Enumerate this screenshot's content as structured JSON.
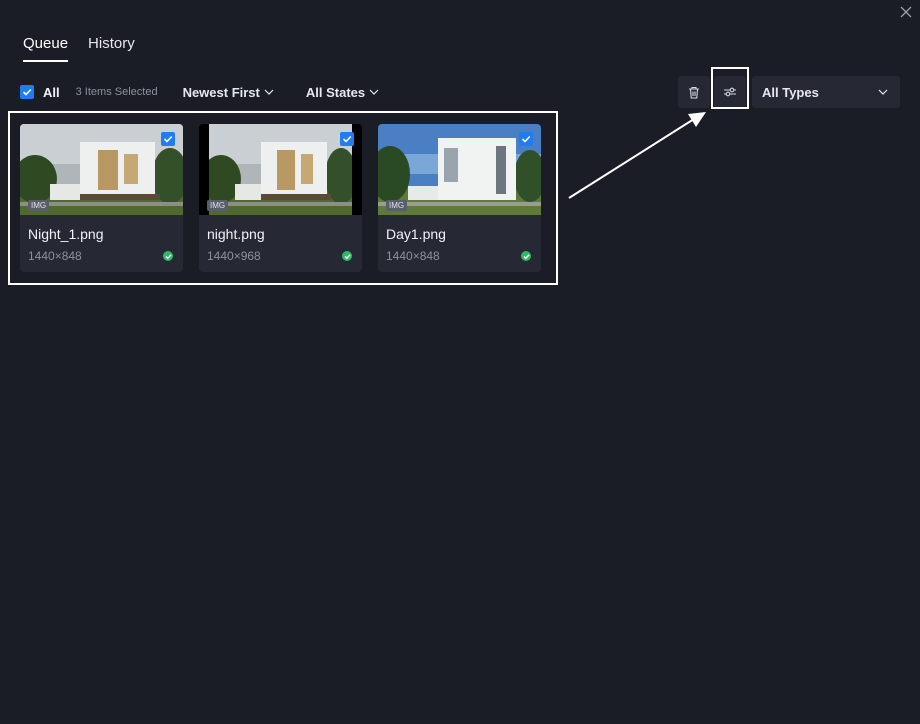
{
  "window": {
    "close_icon": "close-icon"
  },
  "tabs": [
    {
      "label": "Queue",
      "active": true
    },
    {
      "label": "History",
      "active": false
    }
  ],
  "toolbar": {
    "select_all_label": "All",
    "select_all_checked": true,
    "selected_count": "3 Items Selected",
    "sort_label": "Newest First",
    "state_filter_label": "All States",
    "delete_icon": "trash-icon",
    "filter_icon": "sliders-icon",
    "type_filter_label": "All Types"
  },
  "items": [
    {
      "name": "Night_1.png",
      "dimensions": "1440×848",
      "tag": "IMG",
      "checked": true,
      "status": "done"
    },
    {
      "name": "night.png",
      "dimensions": "1440×968",
      "tag": "IMG",
      "checked": true,
      "status": "done"
    },
    {
      "name": "Day1.png",
      "dimensions": "1440×848",
      "tag": "IMG",
      "checked": true,
      "status": "done"
    }
  ],
  "colors": {
    "accent": "#1f7cf2",
    "success": "#2fb866",
    "background": "#1b1d26",
    "panel": "#262934"
  }
}
